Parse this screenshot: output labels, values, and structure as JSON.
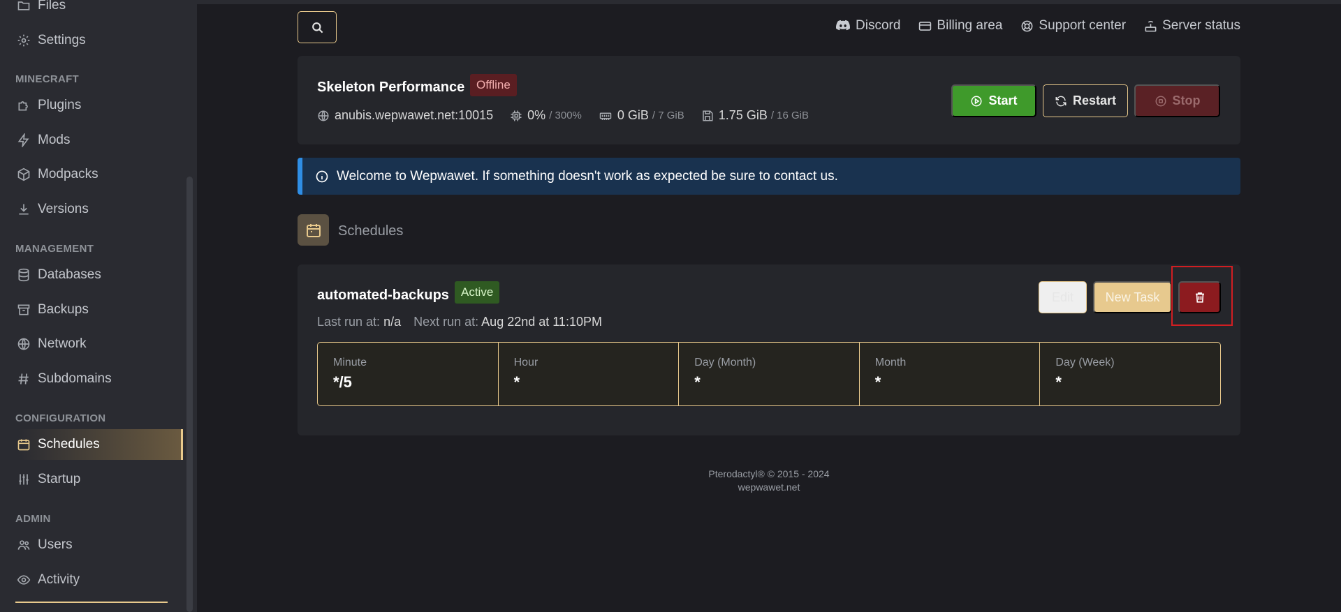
{
  "sidebar": {
    "items_top": [
      {
        "label": "Files",
        "icon": "folder-icon"
      },
      {
        "label": "Settings",
        "icon": "gear-icon"
      }
    ],
    "sections": [
      {
        "title": "MINECRAFT",
        "items": [
          {
            "label": "Plugins",
            "icon": "puzzle-icon"
          },
          {
            "label": "Mods",
            "icon": "bolt-icon"
          },
          {
            "label": "Modpacks",
            "icon": "cube-icon"
          },
          {
            "label": "Versions",
            "icon": "download-icon"
          }
        ]
      },
      {
        "title": "MANAGEMENT",
        "items": [
          {
            "label": "Databases",
            "icon": "database-icon"
          },
          {
            "label": "Backups",
            "icon": "archive-icon"
          },
          {
            "label": "Network",
            "icon": "globe-icon"
          },
          {
            "label": "Subdomains",
            "icon": "hash-icon"
          }
        ]
      },
      {
        "title": "CONFIGURATION",
        "items": [
          {
            "label": "Schedules",
            "icon": "calendar-icon",
            "active": true
          },
          {
            "label": "Startup",
            "icon": "sliders-icon"
          }
        ]
      },
      {
        "title": "ADMIN",
        "items": [
          {
            "label": "Users",
            "icon": "users-icon"
          },
          {
            "label": "Activity",
            "icon": "eye-icon"
          }
        ]
      }
    ]
  },
  "topbar": {
    "links": [
      {
        "label": "Discord",
        "icon": "discord-icon"
      },
      {
        "label": "Billing area",
        "icon": "credit-card-icon"
      },
      {
        "label": "Support center",
        "icon": "lifebuoy-icon"
      },
      {
        "label": "Server status",
        "icon": "router-icon"
      }
    ]
  },
  "server": {
    "name": "Skeleton Performance",
    "status": "Offline",
    "address": "anubis.wepwawet.net:10015",
    "cpu": "0%",
    "cpu_limit": "/ 300%",
    "memory": "0 GiB",
    "memory_limit": "/ 7 GiB",
    "disk": "1.75 GiB",
    "disk_limit": "/ 16 GiB",
    "buttons": {
      "start": "Start",
      "restart": "Restart",
      "stop": "Stop"
    }
  },
  "alert": {
    "text": "Welcome to Wepwawet. If something doesn't work as expected be sure to contact us."
  },
  "page": {
    "title": "Schedules"
  },
  "schedule": {
    "name": "automated-backups",
    "status": "Active",
    "last_run_label": "Last run at:",
    "last_run_value": "n/a",
    "next_run_label": "Next run at:",
    "next_run_value": "Aug 22nd at 11:10PM",
    "buttons": {
      "edit": "Edit",
      "new_task": "New Task"
    },
    "cron": [
      {
        "label": "Minute",
        "value": "*/5"
      },
      {
        "label": "Hour",
        "value": "*"
      },
      {
        "label": "Day (Month)",
        "value": "*"
      },
      {
        "label": "Month",
        "value": "*"
      },
      {
        "label": "Day (Week)",
        "value": "*"
      }
    ]
  },
  "footer": {
    "line1": "Pterodactyl® © 2015 - 2024",
    "line2": "wepwawet.net"
  },
  "colors": {
    "accent": "#e8c98c",
    "start": "#3f9a2b",
    "danger": "#8c1b1f",
    "info": "#2f8ee5",
    "highlight": "#d11e22"
  }
}
